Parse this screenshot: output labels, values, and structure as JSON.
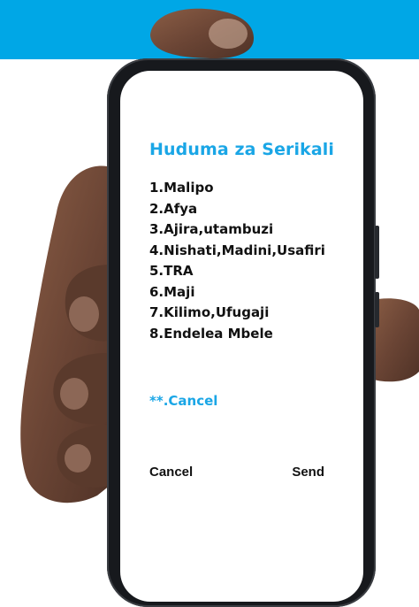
{
  "colors": {
    "band": "#00a7e6",
    "accent": "#1aa6e6",
    "text": "#111111",
    "phone_frame": "#17191d",
    "skin": "#6e4a38"
  },
  "ussd": {
    "title": "Huduma za Serikali",
    "menu_items": [
      "1.Malipo",
      "2.Afya",
      "3.Ajira,utambuzi",
      "4.Nishati,Madini,Usafiri",
      "5.TRA",
      "6.Maji",
      "7.Kilimo,Ufugaji",
      "8.Endelea Mbele"
    ],
    "cancel_option": "**.Cancel",
    "cancel_button": "Cancel",
    "send_button": "Send"
  }
}
